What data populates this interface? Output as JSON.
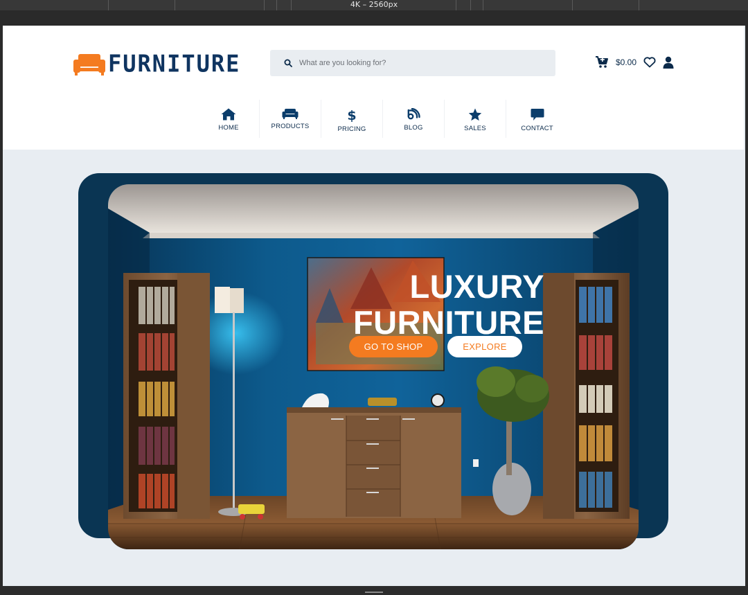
{
  "toolbar": {
    "frame_label": "4K – 2560px"
  },
  "header": {
    "logo_text": "FURNITURE",
    "search": {
      "placeholder": "What are you looking for?",
      "value": ""
    },
    "cart_total": "$0.00"
  },
  "nav": {
    "items": [
      {
        "label": "HOME",
        "icon": "home-icon"
      },
      {
        "label": "PRODUCTS",
        "icon": "sofa-icon"
      },
      {
        "label": "PRICING",
        "icon": "dollar-icon"
      },
      {
        "label": "BLOG",
        "icon": "feed-icon"
      },
      {
        "label": "SALES",
        "icon": "star-icon"
      },
      {
        "label": "CONTACT",
        "icon": "chat-icon"
      }
    ]
  },
  "hero": {
    "title_line1": "LUXURY",
    "title_line2": "FURNITURE",
    "primary_button": "GO TO SHOP",
    "secondary_button": "EXPLORE"
  },
  "colors": {
    "brand_orange": "#f47b20",
    "brand_navy": "#0f3460",
    "page_bg": "#e8edf2",
    "hero_frame": "#0a3553"
  }
}
